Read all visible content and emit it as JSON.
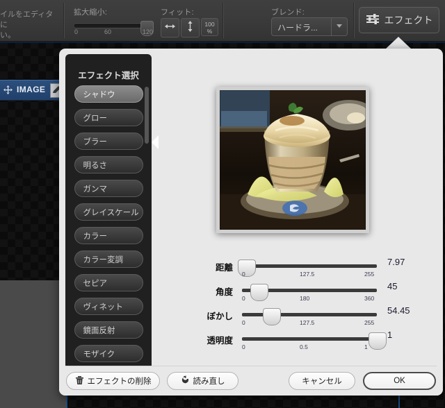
{
  "toolbar": {
    "left_hint_line1": "イルをエディタに",
    "left_hint_line2": "い。",
    "zoom": {
      "label": "拡大縮小:",
      "min": "0",
      "mid": "60",
      "max": "120"
    },
    "fit": {
      "label": "フィット:",
      "horizontal_icon": "fit-horizontal-icon",
      "vertical_icon": "fit-vertical-icon",
      "actual_size_line1": "100",
      "actual_size_line2": "%"
    },
    "blend": {
      "label": "ブレンド:",
      "value": "ハードラ..."
    },
    "effect_button_label": "エフェクト",
    "effect_button_icon": "sliders-icon"
  },
  "canvas": {
    "layer_name": "IMAGE",
    "move_icon": "move-cross-icon",
    "edit_icon": "pencil-edit-icon"
  },
  "popover": {
    "list_title": "エフェクト選択",
    "items": [
      {
        "label": "シャドウ",
        "selected": true
      },
      {
        "label": "グロー",
        "selected": false
      },
      {
        "label": "ブラー",
        "selected": false
      },
      {
        "label": "明るさ",
        "selected": false
      },
      {
        "label": "ガンマ",
        "selected": false
      },
      {
        "label": "グレイスケール",
        "selected": false
      },
      {
        "label": "カラー",
        "selected": false
      },
      {
        "label": "カラー変調",
        "selected": false
      },
      {
        "label": "セピア",
        "selected": false
      },
      {
        "label": "ヴィネット",
        "selected": false
      },
      {
        "label": "鏡面反射",
        "selected": false
      },
      {
        "label": "モザイク",
        "selected": false
      }
    ],
    "preview_alt": "dessert-parfait-photo",
    "sliders": [
      {
        "label": "距離",
        "min": "0",
        "mid": "127.5",
        "max": "255",
        "value": "7.97",
        "fill": 0.031
      },
      {
        "label": "角度",
        "min": "0",
        "mid": "180",
        "max": "360",
        "value": "45",
        "fill": 0.125
      },
      {
        "label": "ぼかし",
        "min": "0",
        "mid": "127.5",
        "max": "255",
        "value": "54.45",
        "fill": 0.214
      },
      {
        "label": "透明度",
        "min": "0",
        "mid": "0.5",
        "max": "1",
        "value": "1",
        "fill": 1.0
      }
    ],
    "footer": {
      "delete_label": "エフェクトの削除",
      "delete_icon": "trash-icon",
      "reload_label": "読み直し",
      "reload_icon": "refresh-arrow-icon",
      "cancel_label": "キャンセル",
      "ok_label": "OK"
    }
  },
  "colors": {
    "popover_bg": "#e8e8e8",
    "list_bg": "#202020",
    "layer_blue": "#2c4f7c",
    "selection_white": "#ffffff"
  }
}
